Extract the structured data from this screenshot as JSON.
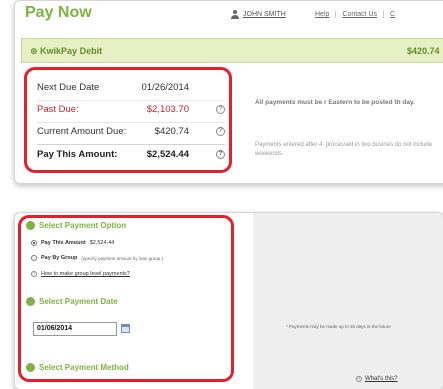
{
  "header": {
    "title": "Pay Now",
    "user_name": "JOHN SMITH",
    "links": [
      "Help",
      "Contact Us",
      "C"
    ]
  },
  "kwikpay": {
    "label": "KwikPay Debit",
    "amount": "$420.74"
  },
  "balance": {
    "rows": [
      {
        "label": "Next Due Date",
        "value": "01/26/2014"
      },
      {
        "label": "Past Due:",
        "value": "$2,103.70"
      },
      {
        "label": "Current Amount Due:",
        "value": "$420.74"
      },
      {
        "label": "Pay This Amount:",
        "value": "$2,524.44"
      }
    ],
    "help_glyph": "?"
  },
  "info": {
    "bold_text": "All payments must be r Eastern to be posted th day.",
    "normal_text": "Payments entered after 4: processed in two busines do not include weekends."
  },
  "steps": {
    "option_title": "Select Payment Option",
    "pay_this_amount_label": "Pay This Amount",
    "pay_this_amount_value": "$2,524.44",
    "pay_by_group_label": "Pay By Group",
    "pay_by_group_note": "(specify payment amount by loan group.)",
    "group_help_link": "How to make group level payments?",
    "date_title": "Select Payment Date",
    "date_value": "01/06/2014",
    "date_note": "* Payments may be made up to 30 days in the future",
    "method_title": "Select Payment Method",
    "whats_this": "What's this?"
  },
  "colors": {
    "brand_green": "#7db341",
    "highlight_red": "#e3202c",
    "kwik_bar_bg": "#e6f0c4"
  }
}
